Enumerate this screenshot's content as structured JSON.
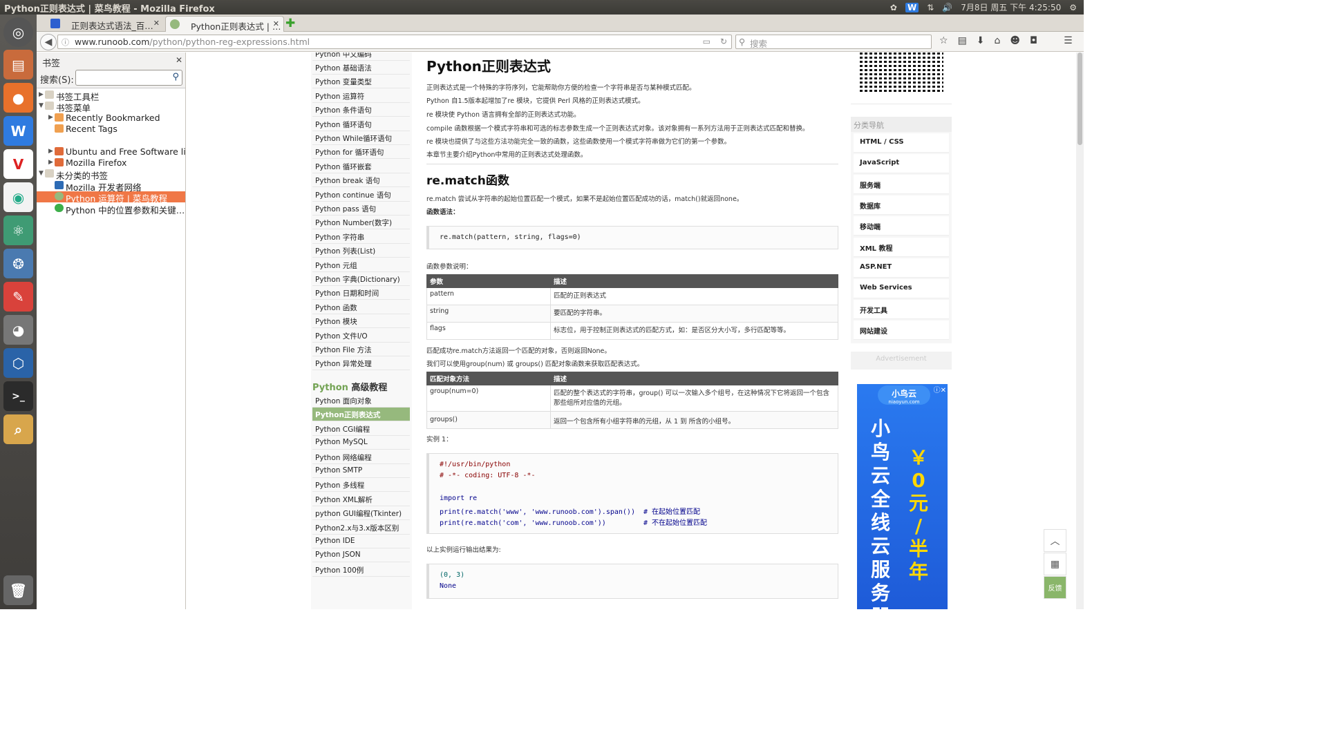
{
  "window": {
    "title": "Python正则表达式 | 菜鸟教程 - Mozilla Firefox"
  },
  "tray": {
    "datetime": "7月8日 周五 下午 4:25:50"
  },
  "tabs": [
    {
      "label": "正则表达式语法_百…"
    },
    {
      "label": "Python正则表达式 | …"
    }
  ],
  "url": {
    "domain": "www.runoob.com",
    "path": "/python/python-reg-expressions.html"
  },
  "search": {
    "placeholder": "搜索"
  },
  "sidebar": {
    "title": "书签",
    "search_label": "搜索(S):",
    "items": [
      {
        "label": "书签工具栏"
      },
      {
        "label": "书签菜单"
      },
      {
        "label": "Recently Bookmarked"
      },
      {
        "label": "Recent Tags"
      },
      {
        "label": "Ubuntu and Free Software links"
      },
      {
        "label": "Mozilla Firefox"
      },
      {
        "label": "未分类的书签"
      },
      {
        "label": "Mozilla 开发者网络"
      },
      {
        "label": "Python 运算符 | 菜鸟教程"
      },
      {
        "label": "Python 中的位置参数和关键…"
      }
    ]
  },
  "leftmenu": {
    "top_cut": "Python 中文编码",
    "items": [
      "Python 基础语法",
      "Python 变量类型",
      "Python 运算符",
      "Python 条件语句",
      "Python 循环语句",
      "Python While循环语句",
      "Python for 循环语句",
      "Python 循环嵌套",
      "Python break 语句",
      "Python continue 语句",
      "Python pass 语句",
      "Python Number(数字)",
      "Python 字符串",
      "Python 列表(List)",
      "Python 元组",
      "Python 字典(Dictionary)",
      "Python 日期和时间",
      "Python 函数",
      "Python 模块",
      "Python 文件I/O",
      "Python File 方法",
      "Python 异常处理"
    ],
    "advanced_head_a": "Python",
    "advanced_head_b": " 高级教程",
    "advanced": [
      "Python 面向对象",
      "Python正则表达式",
      "Python CGI编程",
      "Python MySQL",
      "Python 网络编程",
      "Python SMTP",
      "Python 多线程",
      "Python XML解析",
      "python GUI编程(Tkinter)",
      "Python2.x与3.x版本区别",
      "Python IDE",
      "Python JSON",
      "Python 100例"
    ]
  },
  "article": {
    "title": "Python正则表达式",
    "intro": [
      "正则表达式是一个特殊的字符序列，它能帮助你方便的检查一个字符串是否与某种模式匹配。",
      "Python 自1.5版本起增加了re 模块，它提供 Perl 风格的正则表达式模式。",
      "re 模块使 Python 语言拥有全部的正则表达式功能。",
      "compile 函数根据一个模式字符串和可选的标志参数生成一个正则表达式对象。该对象拥有一系列方法用于正则表达式匹配和替换。",
      "re 模块也提供了与这些方法功能完全一致的函数，这些函数使用一个模式字符串做为它们的第一个参数。",
      "本章节主要介绍Python中常用的正则表达式处理函数。"
    ],
    "h2": "re.match函数",
    "match_desc": "re.match 尝试从字符串的起始位置匹配一个模式，如果不是起始位置匹配成功的话，match()就返回none。",
    "syntax_label": "函数语法：",
    "syntax_code": "re.match(pattern, string, flags=0)",
    "params_label": "函数参数说明：",
    "params_head": [
      "参数",
      "描述"
    ],
    "params": [
      [
        "pattern",
        "匹配的正则表达式"
      ],
      [
        "string",
        "要匹配的字符串。"
      ],
      [
        "flags",
        "标志位，用于控制正则表达式的匹配方式，如：是否区分大小写，多行匹配等等。"
      ]
    ],
    "after_params": [
      "匹配成功re.match方法返回一个匹配的对象，否则返回None。",
      "我们可以使用group(num) 或 groups() 匹配对象函数来获取匹配表达式。"
    ],
    "methods_head": [
      "匹配对象方法",
      "描述"
    ],
    "methods": [
      [
        "group(num=0)",
        "匹配的整个表达式的字符串，group() 可以一次输入多个组号，在这种情况下它将返回一个包含那些组所对应值的元组。"
      ],
      [
        "groups()",
        "返回一个包含所有小组字符串的元组，从 1 到 所含的小组号。"
      ]
    ],
    "example_label": "实例 1：",
    "example_code": [
      "#!/usr/bin/python",
      "# -*- coding: UTF-8 -*-",
      "",
      "import re",
      "print(re.match('www', 'www.runoob.com').span())  # 在起始位置匹配",
      "print(re.match('com', 'www.runoob.com'))         # 不在起始位置匹配"
    ],
    "output_label": "以上实例运行输出结果为:",
    "output_code": [
      "(0, 3)",
      "None"
    ]
  },
  "rightcol": {
    "cat_title": "分类导航",
    "cats": [
      "HTML / CSS",
      "JavaScript",
      "服务端",
      "数据库",
      "移动端",
      "XML 教程",
      "ASP.NET",
      "Web Services",
      "开发工具",
      "网站建设"
    ],
    "ad_label": "Advertisement",
    "ad_logo": "小鸟云",
    "ad_logo_sub": "niaoyun.com",
    "ad_big": "小鸟云全线云服务器",
    "ad_price": "￥0元/半年"
  },
  "float": {
    "feedback": "反馈"
  },
  "colors": {
    "accent_green": "#96b97d",
    "selected_bookmark": "#f07746",
    "ad_blue": "#2a7af0"
  }
}
